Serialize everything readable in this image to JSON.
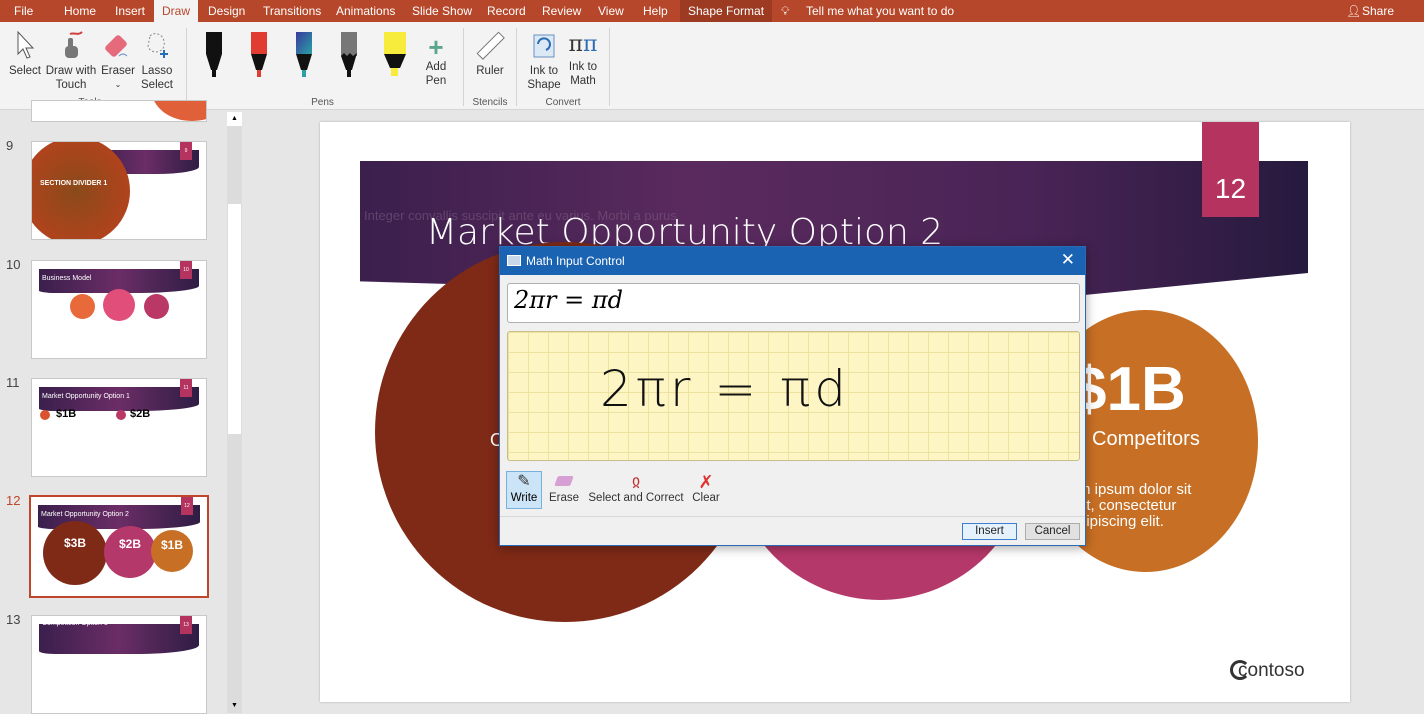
{
  "tabs": [
    "File",
    "Home",
    "Insert",
    "Draw",
    "Design",
    "Transitions",
    "Animations",
    "Slide Show",
    "Record",
    "Review",
    "View",
    "Help",
    "Shape Format"
  ],
  "active_tab": "Draw",
  "tell_me": "Tell me what you want to do",
  "share": "Share",
  "ribbon": {
    "tools": {
      "select": "Select",
      "draw_touch_1": "Draw with",
      "draw_touch_2": "Touch",
      "eraser": "Eraser",
      "lasso_1": "Lasso",
      "lasso_2": "Select",
      "group": "Tools"
    },
    "pens": {
      "colors": [
        "#111111",
        "#e03c31",
        "#2aa0a8",
        "#777777",
        "#f7ec3c"
      ],
      "add_pen_1": "Add",
      "add_pen_2": "Pen",
      "group": "Pens"
    },
    "stencils": {
      "ruler": "Ruler",
      "group": "Stencils"
    },
    "convert": {
      "ink_shape_1": "Ink to",
      "ink_shape_2": "Shape",
      "ink_math_1": "Ink to",
      "ink_math_2": "Math",
      "group": "Convert"
    }
  },
  "thumbnails": [
    {
      "num": "9",
      "title": "SECTION DIVIDER 1",
      "badge": "9"
    },
    {
      "num": "10",
      "title": "Business Model",
      "badge": "10"
    },
    {
      "num": "11",
      "title": "Market Opportunity Option 1",
      "badge": "11",
      "v1": "$1B",
      "v2": "$2B"
    },
    {
      "num": "12",
      "title": "Market Opportunity Option 2",
      "badge": "12",
      "v1": "$3B",
      "v2": "$2B",
      "v3": "$1B",
      "selected": true
    },
    {
      "num": "13",
      "title": "Competition Option 1",
      "badge": "13"
    }
  ],
  "slide": {
    "number": "12",
    "title": "Market Opportunity Option 2",
    "ghost_text": "Integer convallis suscipit ante eu varius. Morbi a purus",
    "circle3": {
      "value": "$1B",
      "label": "Competitors",
      "body1": "m ipsum dolor sit",
      "body2": "et, consectetur",
      "body3": "dipiscing elit."
    },
    "circle1_partial": "O",
    "logo": "contoso",
    "colors": {
      "banner": "#4a2456",
      "badge": "#b5335f",
      "circle1": "#7f2a17",
      "circle2": "#b5386a",
      "circle3": "#c76f24"
    }
  },
  "dialog": {
    "title": "Math Input Control",
    "preview": "2πr = πd",
    "ink": "2πr = πd",
    "tools": [
      "Write",
      "Erase",
      "Select and Correct",
      "Clear"
    ],
    "active_tool": "Write",
    "insert": "Insert",
    "cancel": "Cancel"
  }
}
